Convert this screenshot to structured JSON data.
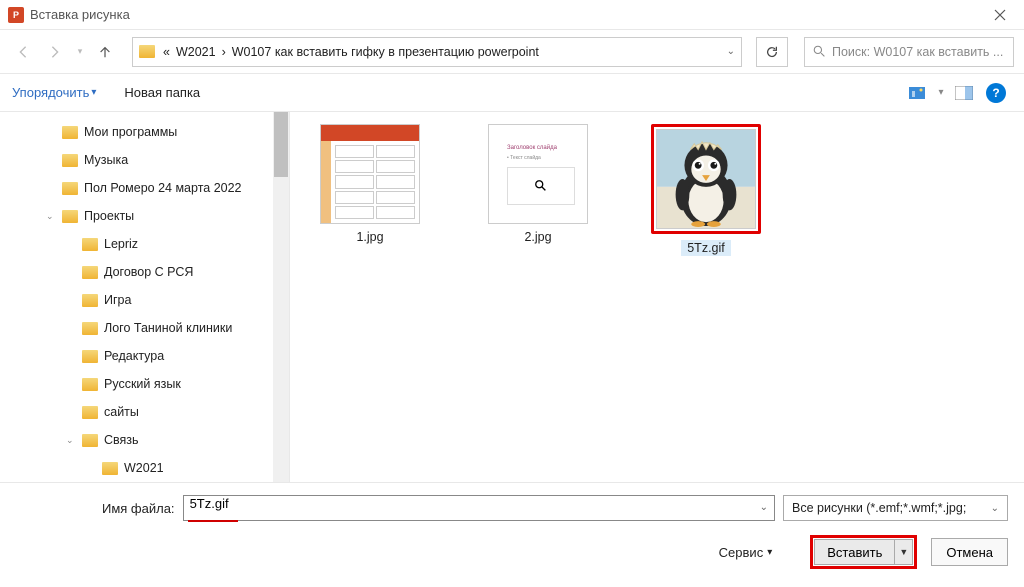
{
  "titlebar": {
    "title": "Вставка рисунка"
  },
  "nav": {
    "crumb_prefix": "«",
    "crumb1": "W2021",
    "crumb2": "W0107 как вставить гифку в презентацию powerpoint"
  },
  "search": {
    "placeholder": "Поиск: W0107 как вставить ..."
  },
  "toolbar": {
    "organize": "Упорядочить",
    "newfolder": "Новая папка"
  },
  "sidebar": {
    "items": [
      {
        "label": "Мои программы",
        "depth": 1
      },
      {
        "label": "Музыка",
        "depth": 1
      },
      {
        "label": "Пол Ромеро 24 марта 2022",
        "depth": 1
      },
      {
        "label": "Проекты",
        "depth": 1,
        "expanded": true
      },
      {
        "label": "Lepriz",
        "depth": 2
      },
      {
        "label": "Договор С РСЯ",
        "depth": 2
      },
      {
        "label": "Игра",
        "depth": 2
      },
      {
        "label": "Лого Таниной клиники",
        "depth": 2
      },
      {
        "label": "Редактура",
        "depth": 2
      },
      {
        "label": "Русский язык",
        "depth": 2
      },
      {
        "label": "сайты",
        "depth": 2
      },
      {
        "label": "Связь",
        "depth": 2,
        "expanded": true
      },
      {
        "label": "W2021",
        "depth": 3
      }
    ]
  },
  "files": {
    "items": [
      {
        "name": "1.jpg",
        "thumb": "ppt"
      },
      {
        "name": "2.jpg",
        "thumb": "doc"
      },
      {
        "name": "5Tz.gif",
        "thumb": "penguin",
        "selected": true
      }
    ]
  },
  "bottom": {
    "filename_label": "Имя файла:",
    "filename_value": "5Tz.gif",
    "filter": "Все рисунки (*.emf;*.wmf;*.jpg;",
    "tools": "Сервис",
    "insert": "Вставить",
    "cancel": "Отмена"
  }
}
